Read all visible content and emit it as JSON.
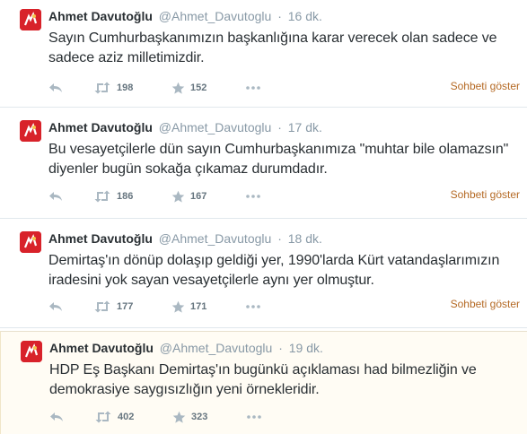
{
  "tweets": [
    {
      "fullname": "Ahmet Davutoğlu",
      "username": "@Ahmet_Davutoglu",
      "sep": "·",
      "time": "16 dk.",
      "text": "Sayın Cumhurbaşkanımızın başkanlığına karar verecek olan sadece ve sadece aziz milletimizdir.",
      "retweets": "198",
      "favorites": "152",
      "conversation_label": "Sohbeti göster"
    },
    {
      "fullname": "Ahmet Davutoğlu",
      "username": "@Ahmet_Davutoglu",
      "sep": "·",
      "time": "17 dk.",
      "text": "Bu vesayetçilerle dün sayın Cumhurbaşkanımıza \"muhtar bile olamazsın\" diyenler bugün sokağa çıkamaz durumdadır.",
      "retweets": "186",
      "favorites": "167",
      "conversation_label": "Sohbeti göster"
    },
    {
      "fullname": "Ahmet Davutoğlu",
      "username": "@Ahmet_Davutoglu",
      "sep": "·",
      "time": "18 dk.",
      "text": "Demirtaş'ın dönüp dolaşıp geldiği yer, 1990'larda Kürt vatandaşlarımızın iradesini yok sayan vesayetçilerle aynı yer olmuştur.",
      "retweets": "177",
      "favorites": "171",
      "conversation_label": "Sohbeti göster"
    },
    {
      "fullname": "Ahmet Davutoğlu",
      "username": "@Ahmet_Davutoglu",
      "sep": "·",
      "time": "19 dk.",
      "text": "HDP Eş Başkanı Demirtaş'ın bugünkü açıklaması had bilmezliğin ve demokrasiye saygısızlığın yeni örnekleridir.",
      "retweets": "402",
      "favorites": "323",
      "conversation_label": ""
    }
  ],
  "colors": {
    "meta": "#8899a6",
    "text": "#292f33",
    "conversation_link": "#b56a25",
    "avatar_bg": "#d8222a",
    "highlight_bg": "#fffcf4"
  },
  "icons": [
    "reply-icon",
    "retweet-icon",
    "favorite-star-icon",
    "more-dots-icon"
  ]
}
